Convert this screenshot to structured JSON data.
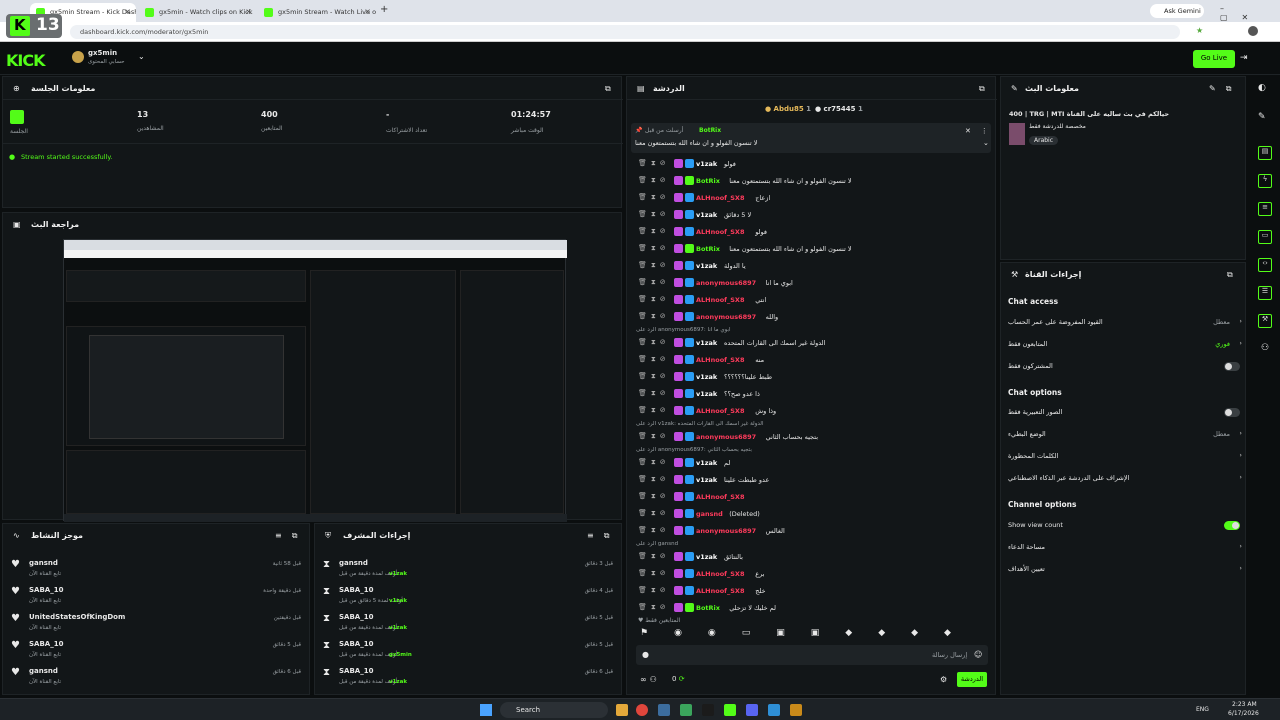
{
  "browser": {
    "tabs": [
      {
        "label": "gx5min Stream - Kick Dashboo"
      },
      {
        "label": "gx5min - Watch clips on Kick"
      },
      {
        "label": "gx5min Stream - Watch Live or"
      }
    ],
    "url": "dashboard.kick.com/moderator/gx5min",
    "gemini_label": "Ask Gemini"
  },
  "header": {
    "logo": "KICK",
    "badge": "13",
    "channel_name": "gx5min",
    "channel_sub": "حسابي المحتوى",
    "go_live": "Go Live"
  },
  "session": {
    "title": "معلومات الجلسة",
    "stats": [
      {
        "value": "01:24:57",
        "label": "الوقت مباشر"
      },
      {
        "value": "-",
        "label": "تعداد الاشتراكات"
      },
      {
        "value": "400",
        "label": "المتابعين"
      },
      {
        "value": "13",
        "label": "المشاهدين"
      }
    ],
    "session_label": "الجلسة",
    "status": "Stream started successfully."
  },
  "preview": {
    "title": "مراجعة البث"
  },
  "activity": {
    "title": "موجز النشاط",
    "items": [
      {
        "user": "gansnd",
        "sub": "تابع القناة الآن",
        "time": "قبل 58 ثانية"
      },
      {
        "user": "SABA_10",
        "sub": "تابع القناة الآن",
        "time": "قبل دقيقة واحدة"
      },
      {
        "user": "UnitedStatesOfKingDom",
        "sub": "تابع القناة الآن",
        "time": "قبل دقيقتين"
      },
      {
        "user": "SABA_10",
        "sub": "تابع القناة الآن",
        "time": "قبل 5 دقائق"
      },
      {
        "user": "gansnd",
        "sub": "تابع القناة الآن",
        "time": "قبل 6 دقائق"
      }
    ]
  },
  "modactions": {
    "title": "إجراءات المشرف",
    "items": [
      {
        "user": "gansnd",
        "sub": "أوقف لمدة دقيقة من قبل",
        "by": "v1zak",
        "time": "قبل 3 دقائق"
      },
      {
        "user": "SABA_10",
        "sub": "أوقف لمدة 5 دقائق من قبل",
        "by": "v1zak",
        "time": "قبل 4 دقائق"
      },
      {
        "user": "SABA_10",
        "sub": "أوقف لمدة دقيقة من قبل",
        "by": "v1zak",
        "time": "قبل 5 دقائق"
      },
      {
        "user": "SABA_10",
        "sub": "أوقف لمدة دقيقة من قبل",
        "by": "gx5min",
        "time": "قبل 5 دقائق"
      },
      {
        "user": "SABA_10",
        "sub": "أوقف لمدة دقيقة من قبل",
        "by": "v1zak",
        "time": "قبل 6 دقائق"
      }
    ]
  },
  "chat": {
    "title": "الدردشة",
    "top_users": [
      {
        "name": "Abdu85",
        "count": "1"
      },
      {
        "name": "cr75445",
        "count": "1"
      }
    ],
    "pinned_by": "أرسلت من قبل",
    "pinned_user": "BotRix",
    "pinned_msg": "لا تنسون الفولو و ان شاء الله بتستمتعون معنا",
    "messages": [
      {
        "user": "v1zak",
        "color": "#ffffff",
        "msg": "فولو"
      },
      {
        "user": "BotRix",
        "color": "#53fc18",
        "msg": "لا تنسون الفولو و ان شاء الله بتستمتعون معنا"
      },
      {
        "user": "ALHnoof_SX8",
        "color": "#ff3b5c",
        "msg": "ازعاج"
      },
      {
        "user": "v1zak",
        "color": "#ffffff",
        "msg": "لا 5 دقائق"
      },
      {
        "user": "ALHnoof_SX8",
        "color": "#ff3b5c",
        "msg": "فولو"
      },
      {
        "user": "BotRix",
        "color": "#53fc18",
        "msg": "لا تنسون الفولو و ان شاء الله بتستمتعون معنا"
      },
      {
        "user": "v1zak",
        "color": "#ffffff",
        "msg": "يا الدولة"
      },
      {
        "user": "anonymous6897",
        "color": "#ff3b5c",
        "msg": "ابوي ما انا"
      },
      {
        "user": "ALHnoof_SX8",
        "color": "#ff3b5c",
        "msg": "انتي"
      },
      {
        "user": "anonymous6897",
        "color": "#ff3b5c",
        "msg": "والله"
      },
      {
        "user": "v1zak",
        "color": "#ffffff",
        "msg": "الدولة غير اسمك الى القارات المتحده"
      },
      {
        "user": "ALHnoof_SX8",
        "color": "#ff3b5c",
        "msg": "منه"
      },
      {
        "user": "v1zak",
        "color": "#ffffff",
        "msg": "طبط علينا؟؟؟؟؟؟"
      },
      {
        "user": "v1zak",
        "color": "#ffffff",
        "msg": "ذا عدو صح؟؟"
      },
      {
        "user": "ALHnoof_SX8",
        "color": "#ff3b5c",
        "msg": "وذا وش"
      },
      {
        "user": "anonymous6897",
        "color": "#ff3b5c",
        "msg": "بتجيه بحساب الثاني"
      },
      {
        "user": "v1zak",
        "color": "#ffffff",
        "msg": "لم"
      },
      {
        "user": "v1zak",
        "color": "#ffffff",
        "msg": "عدو طبطت علينا"
      },
      {
        "user": "ALHnoof_SX8",
        "color": "#ff3b5c",
        "msg": ""
      },
      {
        "user": "gansnd",
        "color": "#ff3b5c",
        "msg": "(Deleted)"
      },
      {
        "user": "anonymous6897",
        "color": "#ff3b5c",
        "msg": "الغالس"
      },
      {
        "user": "v1zak",
        "color": "#ffffff",
        "msg": "بالنتائق"
      },
      {
        "user": "ALHnoof_SX8",
        "color": "#ff3b5c",
        "msg": "برع"
      },
      {
        "user": "ALHnoof_SX8",
        "color": "#ff3b5c",
        "msg": "خلج"
      },
      {
        "user": "BotRix",
        "color": "#53fc18",
        "msg": "لم خليك لا تزحلي"
      }
    ],
    "reply_notes": [
      "الرد على anonymous6897: ابوي ما انا",
      "الرد على v1zak: الدولة غير اسمك الى القارات المتحده",
      "الرد على anonymous6897: بتجيه بحساب الثاني",
      "الرد على gansnd"
    ],
    "followers_only": "المتابعين فقط",
    "input_placeholder": "إرسال رسالة",
    "counter": "0",
    "send_label": "الدردشة"
  },
  "stream_info": {
    "title": "معلومات البث",
    "stream_title": "400 | TRG | MTI حيالكم في بث ساليه على القناة",
    "category": "مخصصة للدردشة فقط",
    "language": "Arabic"
  },
  "channel_actions": {
    "title": "إجراءات القناة",
    "chat_access": "Chat access",
    "chat_access_rows": [
      {
        "label": "القيود المفروضة على عمر الحساب",
        "value": "معطل"
      },
      {
        "label": "المتابعون فقط",
        "value": "فوري"
      },
      {
        "label": "المشتركون فقط",
        "value": ""
      }
    ],
    "chat_options": "Chat options",
    "chat_options_rows": [
      {
        "label": "الصور التعبيرية فقط",
        "value": ""
      },
      {
        "label": "الوضع البطيء",
        "value": "معطل"
      },
      {
        "label": "الكلمات المحظورة",
        "value": ""
      },
      {
        "label": "الإشراف على الدردشة عبر الذكاء الاصطناعي",
        "value": ""
      }
    ],
    "channel_options": "Channel options",
    "channel_options_rows": [
      {
        "label": "Show view count",
        "value": ""
      },
      {
        "label": "مساحة الدعاء",
        "value": ""
      },
      {
        "label": "تعيين الأهداف",
        "value": ""
      }
    ]
  },
  "taskbar": {
    "search": "Search",
    "lang": "ENG",
    "time": "2:23 AM",
    "date": "6/17/2026"
  }
}
